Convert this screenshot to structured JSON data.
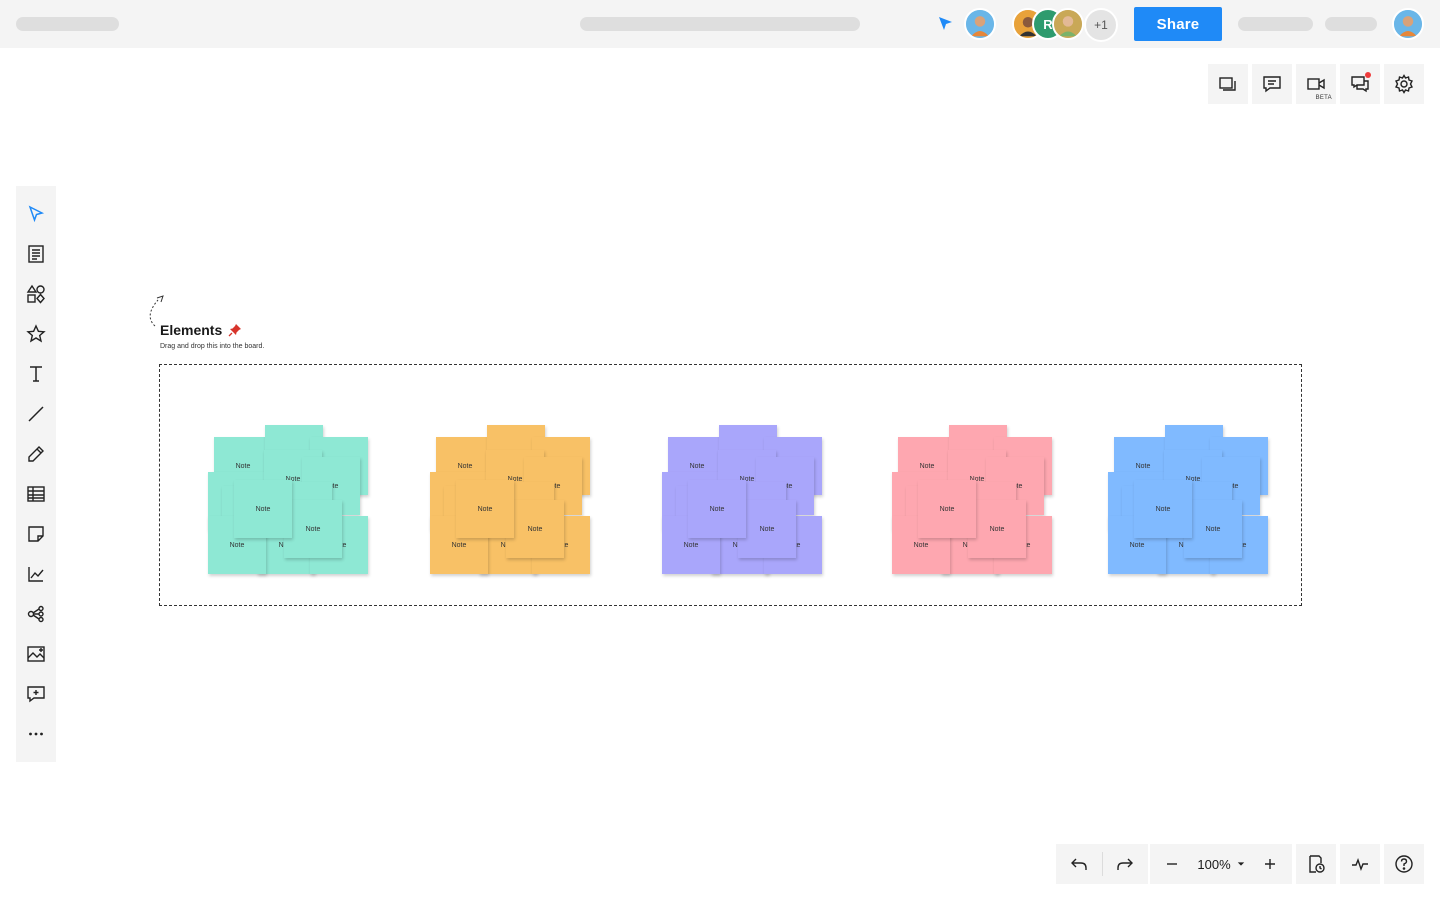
{
  "header": {
    "share_label": "Share",
    "collaborators": [
      {
        "initial": "",
        "color": "#e8a23a"
      },
      {
        "initial": "R",
        "color": "#2e9b6e"
      },
      {
        "initial": "",
        "color": "#c9a857"
      }
    ],
    "more_count": "+1",
    "accent": "#1f8af7"
  },
  "right_tools": {
    "video_badge": "BETA",
    "icons": [
      "presentation-icon",
      "comment-icon",
      "video-icon",
      "chat-icon",
      "gear-icon"
    ]
  },
  "left_toolbar": {
    "icons": [
      "select-cursor-icon",
      "template-icon",
      "shapes-icon",
      "star-icon",
      "text-icon",
      "line-icon",
      "pen-icon",
      "table-icon",
      "sticky-note-icon",
      "chart-icon",
      "mind-map-icon",
      "image-icon",
      "comment-add-icon",
      "more-icon"
    ]
  },
  "board": {
    "title": "Elements",
    "subtitle": "Drag and drop this into the board.",
    "note_label": "Note",
    "note_colors": [
      "#8ee8d4",
      "#f8c166",
      "#a9a6fb",
      "#fea7b0",
      "#80baff"
    ]
  },
  "bottom": {
    "zoom": "100%"
  }
}
